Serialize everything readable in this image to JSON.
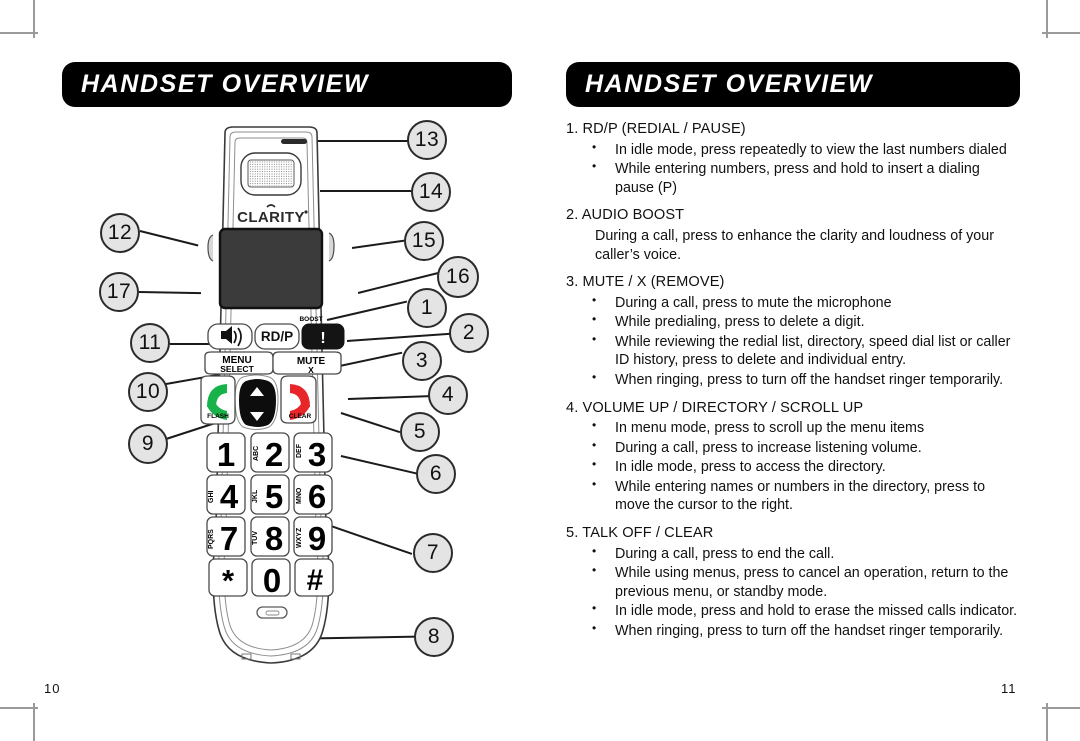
{
  "document": {
    "type": "product-manual-spread",
    "left_page": {
      "header": "HANDSET OVERVIEW",
      "folio": "10",
      "figure": {
        "name": "handset-diagram",
        "brand_logo": "CLARITY",
        "labels": {
          "boost": "BOOST",
          "redial": "RD/P",
          "menu_line1": "MENU",
          "menu_line2": "SELECT",
          "mute_line1": "MUTE",
          "mute_line2": "X",
          "flash": "FLASH",
          "clear": "CLEAR",
          "exclaim": "!"
        },
        "keypad": [
          {
            "digit": "1",
            "letters": ""
          },
          {
            "digit": "2",
            "letters": "ABC"
          },
          {
            "digit": "3",
            "letters": "DEF"
          },
          {
            "digit": "4",
            "letters": "GHI"
          },
          {
            "digit": "5",
            "letters": "JKL"
          },
          {
            "digit": "6",
            "letters": "MNO"
          },
          {
            "digit": "7",
            "letters": "PQRS"
          },
          {
            "digit": "8",
            "letters": "TUV"
          },
          {
            "digit": "9",
            "letters": "WXYZ"
          },
          {
            "digit": "*",
            "letters": ""
          },
          {
            "digit": "0",
            "letters": ""
          },
          {
            "digit": "#",
            "letters": ""
          }
        ],
        "callouts": [
          {
            "id": "13",
            "label": "13"
          },
          {
            "id": "14",
            "label": "14"
          },
          {
            "id": "12",
            "label": "12"
          },
          {
            "id": "15",
            "label": "15"
          },
          {
            "id": "16",
            "label": "16"
          },
          {
            "id": "17",
            "label": "17"
          },
          {
            "id": "1",
            "label": "1"
          },
          {
            "id": "11",
            "label": "11"
          },
          {
            "id": "2",
            "label": "2"
          },
          {
            "id": "3",
            "label": "3"
          },
          {
            "id": "10",
            "label": "10"
          },
          {
            "id": "4",
            "label": "4"
          },
          {
            "id": "9",
            "label": "9"
          },
          {
            "id": "5",
            "label": "5"
          },
          {
            "id": "6",
            "label": "6"
          },
          {
            "id": "7",
            "label": "7"
          },
          {
            "id": "8",
            "label": "8"
          }
        ]
      }
    },
    "right_page": {
      "header": "HANDSET OVERVIEW",
      "folio": "11",
      "sections": [
        {
          "number": "1.",
          "title": "1. RD/P (REDIAL / PAUSE)",
          "style": "bullets",
          "items": [
            "In idle mode, press repeatedly to view the last numbers dialed",
            "While entering numbers, press and hold to insert a dialing pause (P)"
          ]
        },
        {
          "number": "2.",
          "title": "2. AUDIO BOOST",
          "style": "paragraph",
          "items": [
            "During a call, press to enhance the clarity and loudness of your caller’s voice."
          ]
        },
        {
          "number": "3.",
          "title": "3. MUTE / X (REMOVE)",
          "style": "bullets",
          "items": [
            "During a call, press to mute the microphone",
            "While predialing, press to delete a digit.",
            "While reviewing the redial list, directory, speed dial list or caller ID history, press to delete and individual entry.",
            "When ringing, press to turn off the handset ringer temporarily."
          ]
        },
        {
          "number": "4.",
          "title": "4. VOLUME UP / DIRECTORY / SCROLL UP",
          "style": "bullets",
          "items": [
            "In menu mode, press to scroll up the menu items",
            "During a call, press to increase listening volume.",
            "In idle mode, press to access the directory.",
            "While entering names or numbers in the directory, press to move the cursor to the right."
          ]
        },
        {
          "number": "5.",
          "title": "5. TALK OFF / CLEAR",
          "style": "bullets",
          "items": [
            "During a call, press to end the call.",
            "While using menus, press to cancel an operation, return to the previous menu, or standby mode.",
            "In idle mode, press and hold to erase the missed calls indicator.",
            "When ringing, press to turn off the handset ringer temporarily."
          ]
        }
      ]
    },
    "colors": {
      "header_bg": "#000000",
      "header_text": "#ffffff",
      "body_text": "#111111",
      "callout_fill": "#e4e4e4",
      "callout_stroke": "#2b2b2b",
      "talk_green": "#18b24a",
      "clear_red": "#e8262a",
      "lcd": "#3a3a3a"
    }
  }
}
